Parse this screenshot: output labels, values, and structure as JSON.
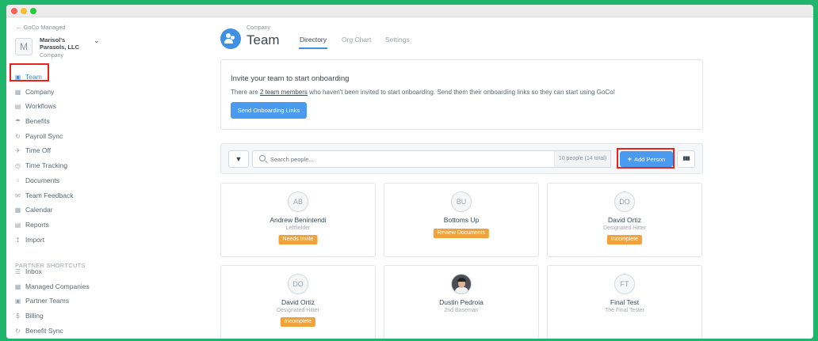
{
  "window": {
    "buttons": [
      "close",
      "minimize",
      "maximize"
    ]
  },
  "sidebar": {
    "back_link": "← GoCo Managed",
    "company_initial": "M",
    "company_name": "Marisol's Parasols, LLC",
    "company_type": "Company",
    "items": [
      {
        "label": "Team",
        "icon": "team-icon",
        "active": true
      },
      {
        "label": "Company",
        "icon": "building-icon"
      },
      {
        "label": "Workflows",
        "icon": "workflows-icon"
      },
      {
        "label": "Benefits",
        "icon": "umbrella-icon"
      },
      {
        "label": "Payroll Sync",
        "icon": "sync-icon"
      },
      {
        "label": "Time Off",
        "icon": "plane-icon"
      },
      {
        "label": "Time Tracking",
        "icon": "clock-icon"
      },
      {
        "label": "Documents",
        "icon": "document-icon"
      },
      {
        "label": "Team Feedback",
        "icon": "feedback-icon"
      },
      {
        "label": "Calendar",
        "icon": "calendar-icon"
      },
      {
        "label": "Reports",
        "icon": "reports-icon"
      },
      {
        "label": "Import",
        "icon": "import-icon"
      }
    ],
    "shortcuts_label": "PARTNER SHORTCUTS",
    "shortcuts": [
      {
        "label": "Inbox",
        "icon": "inbox-icon"
      },
      {
        "label": "Managed Companies",
        "icon": "building-icon"
      },
      {
        "label": "Partner Teams",
        "icon": "team-icon"
      },
      {
        "label": "Billing",
        "icon": "dollar-icon"
      },
      {
        "label": "Benefit Sync",
        "icon": "sync-icon"
      }
    ]
  },
  "header": {
    "subtitle": "Company",
    "title": "Team",
    "tabs": [
      {
        "label": "Directory",
        "active": true
      },
      {
        "label": "Org Chart"
      },
      {
        "label": "Settings"
      }
    ]
  },
  "onboarding": {
    "title": "Invite your team to start onboarding",
    "text_before": "There are ",
    "link": "2 team members",
    "text_after": " who haven't been invited to start onboarding. Send them their onboarding links so they can start using GoCo!",
    "button": "Send Onboarding Links"
  },
  "toolbar": {
    "search_placeholder": "Search people...",
    "count": "10 people (14 total)",
    "add_button": "Add Person"
  },
  "people": [
    {
      "initials": "AB",
      "name": "Andrew Benintendi",
      "role": "Leftfielder",
      "status": "Needs Invite"
    },
    {
      "initials": "BU",
      "name": "Bottoms Up",
      "role": "",
      "status": "Review Documents"
    },
    {
      "initials": "DO",
      "name": "David Ortiz",
      "role": "Designated Hitter",
      "status": "Incomplete"
    },
    {
      "initials": "DO",
      "name": "David Ortiz",
      "role": "Designated Hitter",
      "status": "Incomplete"
    },
    {
      "initials": "",
      "name": "Dustin Pedroia",
      "role": "2nd Baseman",
      "status": "",
      "photo": true
    },
    {
      "initials": "FT",
      "name": "Final Test",
      "role": "The Final Tester",
      "status": ""
    }
  ],
  "colors": {
    "accent": "#3f8fe3",
    "badge": "#f0a33c",
    "highlight": "#e8231d",
    "frame": "#1fb56a"
  }
}
